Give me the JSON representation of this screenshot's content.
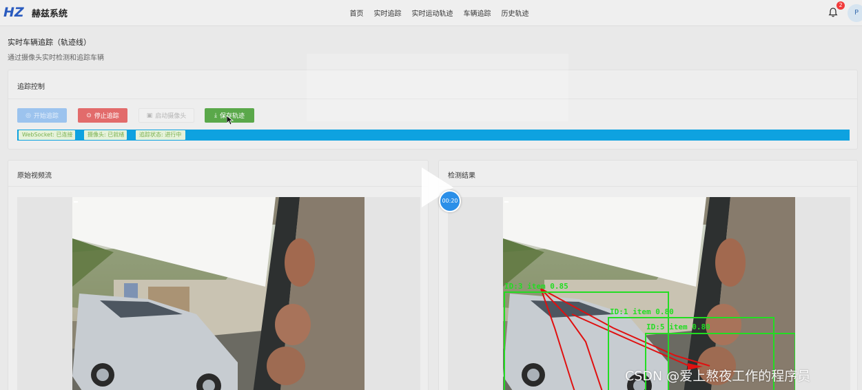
{
  "app": {
    "name": "赫兹系统",
    "logo_letters": "HZ"
  },
  "nav": {
    "items": [
      "首页",
      "实时追踪",
      "实时运动轨迹",
      "车辆追踪",
      "历史轨迹"
    ]
  },
  "header": {
    "notification_count": "2",
    "avatar_letter": "P"
  },
  "page": {
    "title": "实时车辆追踪（轨迹线）",
    "subtitle": "通过摄像头实时检测和追踪车辆"
  },
  "control": {
    "title": "追踪控制",
    "buttons": {
      "start": "开始追踪",
      "stop": "停止追踪",
      "camera": "启动摄像头",
      "save": "保存轨迹"
    },
    "status": {
      "websocket": "WebSocket: 已连接",
      "camera": "摄像头: 已就绪",
      "tracking": "追踪状态: 进行中"
    }
  },
  "panels": {
    "original": "原始视频流",
    "result": "检测结果"
  },
  "video": {
    "timer": "00:20"
  },
  "detections": [
    {
      "label": "ID:3 item 0.85"
    },
    {
      "label": "ID:1 item 0.80"
    },
    {
      "label": "ID:5 item 0.80"
    }
  ],
  "watermark": "CSDN @爱上熬夜工作的程序员",
  "colors": {
    "primary": "#409eff",
    "danger": "#e26b6b",
    "success": "#5aa84a",
    "status_bar": "#0ea2e0",
    "box": "#22dd22",
    "track": "#e01010"
  },
  "icons": {
    "bell": "bell-icon",
    "start": "play-circle-icon",
    "stop": "stop-circle-icon",
    "camera": "camera-icon",
    "save": "download-icon"
  }
}
